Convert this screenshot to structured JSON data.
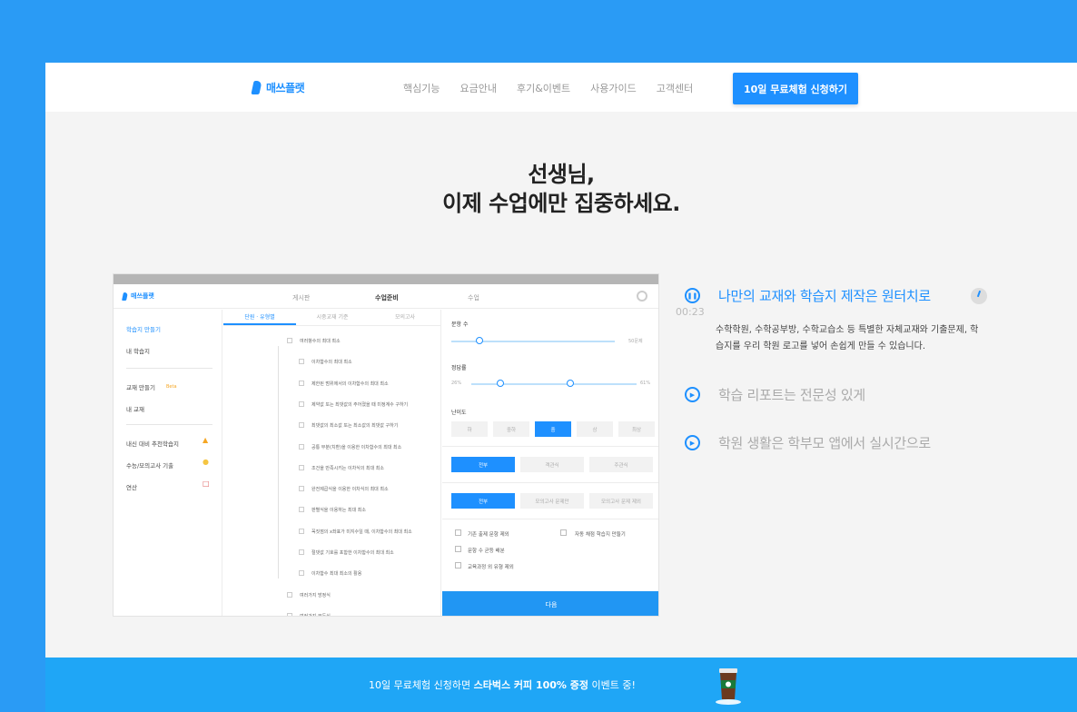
{
  "brand": {
    "logo_text": "매쓰플랫",
    "accent": "#1e90ff",
    "background": "#2a9bf5"
  },
  "nav": {
    "items": [
      "핵심기능",
      "요금안내",
      "후기&이벤트",
      "사용가이드",
      "고객센터"
    ],
    "cta": "10일 무료체험 신청하기"
  },
  "hero": {
    "line1": "선생님,",
    "line2": "이제 수업에만 집중하세요."
  },
  "mock_app": {
    "logo": "매쓰플랫",
    "tabs": [
      "게시판",
      "수업준비",
      "수업"
    ],
    "sidebar": [
      "학습지 만들기",
      "내 학습지",
      "교재 만들기",
      "내 교재",
      "내신 대비 추천학습지",
      "수능/모의고사 기출",
      "연산"
    ],
    "sidebar_badge": "Beta",
    "subtabs": [
      "단원 · 유형별",
      "시중교재 기준",
      "모의고사"
    ],
    "list": [
      "여러항수의 최대 최소",
      "이차함수의 최대 최소",
      "제한된 범위에서의 이차함수의 최대 최소",
      "제약값 또는 최댓값의 주어졌을 때 미정계수 구하기",
      "최댓값의 최소값 또는 최소값의 최댓값 구하기",
      "공통 부분(치환)을 이용한 이차함수의 최대 최소",
      "조건을 만족시키는 이차식의 최대 최소",
      "완전제곱식을 이용한 이차식의 최대 최소",
      "판별식을 이용하는 최대 최소",
      "꼭짓점의 x좌표가 미지수일 때, 이차함수의 최대 최소",
      "절댓값 기호를 포함한 이차함수의 최대 최소",
      "이차함수 최대 최소의 활용",
      "여러가지 방정식",
      "여러가지 부등식"
    ],
    "count_label": "문항 수",
    "count_value": "50문제",
    "rate_label": "정답률",
    "rate_min": "26%",
    "rate_max": "61%",
    "difficulty_label": "난이도",
    "difficulty": [
      "하",
      "중하",
      "중",
      "상",
      "최상"
    ],
    "difficulty_selected": 2,
    "type_seg": [
      "전부",
      "객관식",
      "주관식"
    ],
    "source_seg": [
      "전부",
      "모의고사 문제만",
      "모의고사 문제 제외"
    ],
    "options": [
      "기존 출제 문항 제외",
      "자동 채점 학습지 만들기",
      "문항 수 균등 배분",
      "교육과정 외 유형 제외"
    ],
    "next": "다음"
  },
  "features": [
    {
      "title": "나만의 교재와 학습지 제작은 원터치로",
      "icon": "pause-icon",
      "active": true
    },
    {
      "title": "학습 리포트는 전문성 있게",
      "icon": "play-icon",
      "active": false
    },
    {
      "title": "학원 생활은 학부모 앱에서 실시간으로",
      "icon": "play-icon",
      "active": false
    }
  ],
  "feature_time": "00:23",
  "feature_desc": "수학학원, 수학공부방, 수학교습소 등 특별한 자체교재와 기출문제, 학습지를 우리 학원 로고를 넣어 손쉽게 만들 수 있습니다.",
  "promo": {
    "prefix": "10일 무료체험 신청하면 ",
    "bold": "스타벅스 커피 100% 증정",
    "suffix": " 이벤트 중!"
  }
}
